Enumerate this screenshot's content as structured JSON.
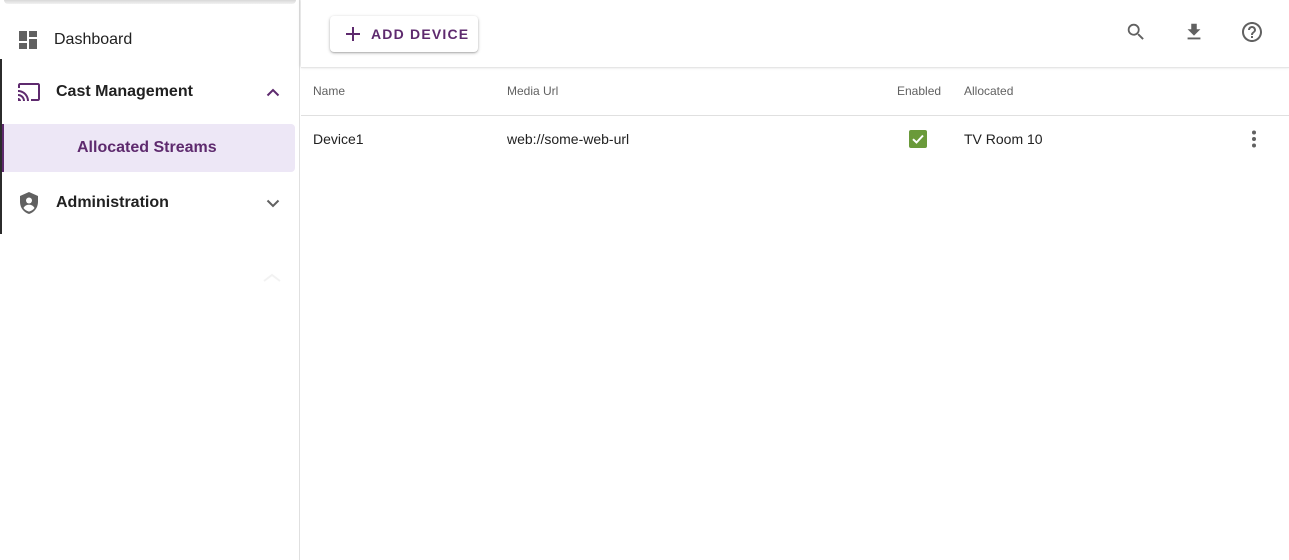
{
  "sidebar": {
    "dashboard_label": "Dashboard",
    "cast_management_label": "Cast Management",
    "allocated_streams_label": "Allocated Streams",
    "administration_label": "Administration"
  },
  "toolbar": {
    "add_device_label": "ADD DEVICE",
    "icons": [
      "search-icon",
      "download-icon",
      "help-icon"
    ]
  },
  "table": {
    "columns": {
      "name": "Name",
      "media_url": "Media Url",
      "enabled": "Enabled",
      "allocated": "Allocated"
    },
    "rows": [
      {
        "name": "Device1",
        "media_url": "web://some-web-url",
        "enabled": true,
        "allocated": "TV Room 10"
      }
    ]
  },
  "colors": {
    "accent": "#5e2a6e",
    "selected_bg": "#ede7f6",
    "checkbox": "#6a9a3a"
  }
}
